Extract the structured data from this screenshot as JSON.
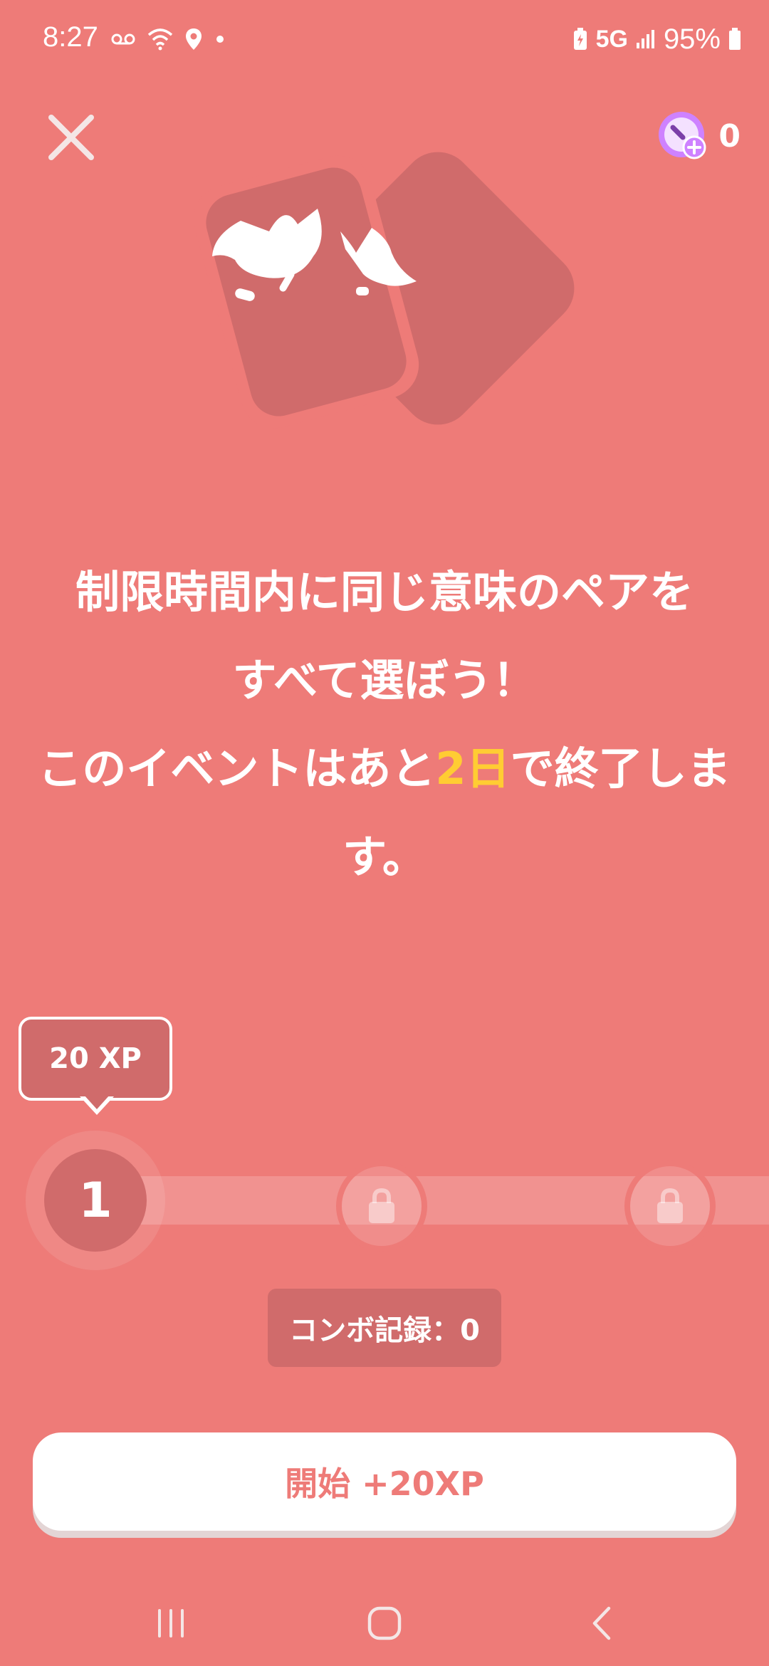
{
  "status_bar": {
    "time": "8:27",
    "network": "5G",
    "battery": "95%"
  },
  "header": {
    "gem_count": "0"
  },
  "headline": {
    "line1": "制限時間内に同じ意味のペアを",
    "line2": "すべて選ぼう！",
    "line3_prefix": "このイベントはあと",
    "line3_highlight": "2日",
    "line3_suffix": "で終了しま",
    "line4": "す。"
  },
  "progress": {
    "xp_tooltip": "20 XP",
    "current_level": "1"
  },
  "combo": {
    "label": "コンボ記録：0"
  },
  "start_button": {
    "label": "開始 +20XP"
  },
  "colors": {
    "background": "#EE7B78",
    "accent_highlight": "#FFCC33",
    "card": "#D06B6B"
  },
  "icons": [
    "close-icon",
    "gem-plus-icon",
    "card-duo-icon",
    "lock-icon"
  ]
}
